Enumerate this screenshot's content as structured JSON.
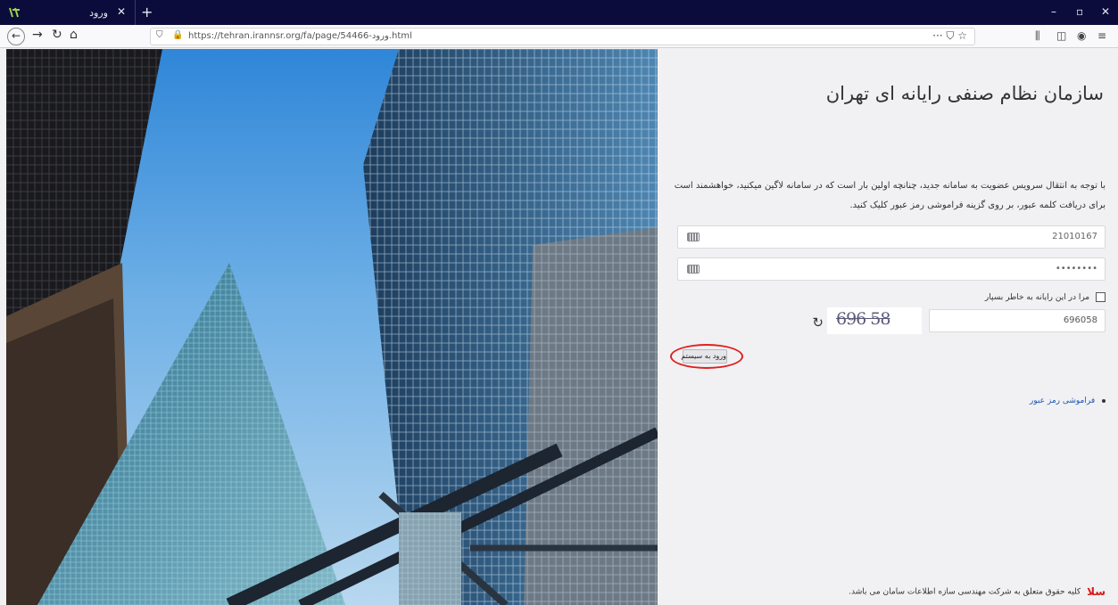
{
  "browser": {
    "tab_title": "ورود",
    "tab_close": "✕",
    "new_tab": "+",
    "url": "https://tehran.irannsr.org/fa/page/54466-ورود.html",
    "url_actions": "··· ⛉ ☆",
    "win_minimize": "–",
    "win_maximize": "▫",
    "win_close": "✕"
  },
  "page": {
    "org_title": "سازمان نظام صنفی رایانه ای تهران",
    "notice": "با توجه به انتقال سرویس عضویت به سامانه جدید، چنانچه اولین بار است که در سامانه لاگین میکنید، خواهشمند است برای دریافت کلمه عبور، بر روی گزینه فراموشی رمز عبور کلیک کنید.",
    "username_value": "21010167",
    "password_value": "••••••••",
    "remember_label": "مرا در این رایانه به خاطر بسپار",
    "captcha_value": "696058",
    "captcha_image_text": "696 58",
    "login_button": "ورود به سیستم",
    "forgot_password": "فراموشی رمز عبور",
    "footer": "کلیه حقوق متعلق به شرکت مهندسی سازه اطلاعات سامان می باشد.",
    "footer_logo": "سلا"
  },
  "colors": {
    "tabbar": "#0c0c3c",
    "highlight": "#e02020",
    "link": "#1a56b0"
  }
}
